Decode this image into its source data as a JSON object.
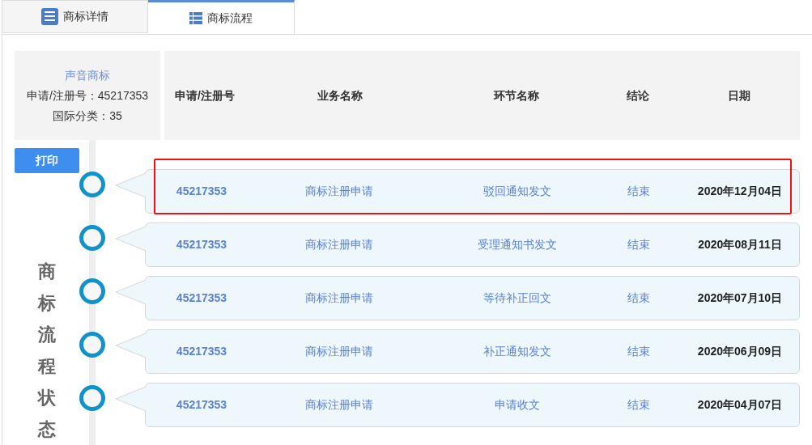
{
  "tabs": [
    {
      "label": "商标详情",
      "selected": false
    },
    {
      "label": "商标流程",
      "selected": true
    }
  ],
  "trademark": {
    "type": "声音商标",
    "reg_no": "申请/注册号：45217353",
    "class": "国际分类：35"
  },
  "columns": [
    "申请/注册号",
    "业务名称",
    "环节名称",
    "结论",
    "日期"
  ],
  "print_button": "打印",
  "side_title": "商标流程状态",
  "rows": [
    {
      "reg_no": "45217353",
      "business": "商标注册申请",
      "step": "驳回通知发文",
      "result": "结束",
      "date": "2020年12月04日",
      "highlighted": true
    },
    {
      "reg_no": "45217353",
      "business": "商标注册申请",
      "step": "受理通知书发文",
      "result": "结束",
      "date": "2020年08月11日",
      "highlighted": false
    },
    {
      "reg_no": "45217353",
      "business": "商标注册申请",
      "step": "等待补正回文",
      "result": "结束",
      "date": "2020年07月10日",
      "highlighted": false
    },
    {
      "reg_no": "45217353",
      "business": "商标注册申请",
      "step": "补正通知发文",
      "result": "结束",
      "date": "2020年06月09日",
      "highlighted": false
    },
    {
      "reg_no": "45217353",
      "business": "商标注册申请",
      "step": "申请收文",
      "result": "结束",
      "date": "2020年04月07日",
      "highlighted": false
    }
  ]
}
